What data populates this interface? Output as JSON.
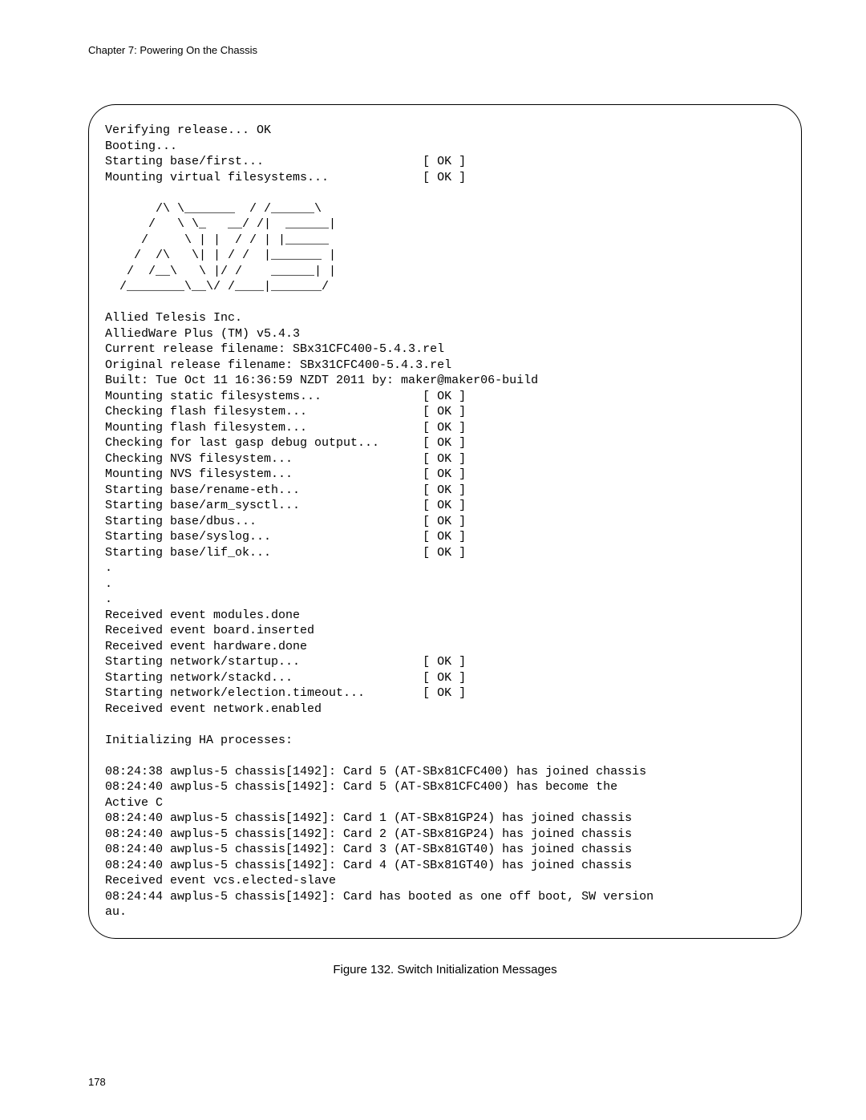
{
  "chapter": "Chapter 7: Powering On the Chassis",
  "console_text": "Verifying release... OK\nBooting...\nStarting base/first...                      [ OK ]\nMounting virtual filesystems...             [ OK ]\n\n       /\\ \\_______  / /______\\\n      /   \\ \\_   __/ /|  ______|\n     /     \\ | |  / / | |______\n    /  /\\   \\| | / /  |_______ |\n   /  /__\\   \\ |/ /    ______| |\n  /________\\__\\/ /____|_______/\n\nAllied Telesis Inc.\nAlliedWare Plus (TM) v5.4.3\nCurrent release filename: SBx31CFC400-5.4.3.rel\nOriginal release filename: SBx31CFC400-5.4.3.rel\nBuilt: Tue Oct 11 16:36:59 NZDT 2011 by: maker@maker06-build\nMounting static filesystems...              [ OK ]\nChecking flash filesystem...                [ OK ]\nMounting flash filesystem...                [ OK ]\nChecking for last gasp debug output...      [ OK ]\nChecking NVS filesystem...                  [ OK ]\nMounting NVS filesystem...                  [ OK ]\nStarting base/rename-eth...                 [ OK ]\nStarting base/arm_sysctl...                 [ OK ]\nStarting base/dbus...                       [ OK ]\nStarting base/syslog...                     [ OK ]\nStarting base/lif_ok...                     [ OK ]\n.\n.\n.\nReceived event modules.done\nReceived event board.inserted\nReceived event hardware.done\nStarting network/startup...                 [ OK ]\nStarting network/stackd...                  [ OK ]\nStarting network/election.timeout...        [ OK ]\nReceived event network.enabled\n\nInitializing HA processes:\n\n08:24:38 awplus-5 chassis[1492]: Card 5 (AT-SBx81CFC400) has joined chassis\n08:24:40 awplus-5 chassis[1492]: Card 5 (AT-SBx81CFC400) has become the \nActive C\n08:24:40 awplus-5 chassis[1492]: Card 1 (AT-SBx81GP24) has joined chassis\n08:24:40 awplus-5 chassis[1492]: Card 2 (AT-SBx81GP24) has joined chassis\n08:24:40 awplus-5 chassis[1492]: Card 3 (AT-SBx81GT40) has joined chassis\n08:24:40 awplus-5 chassis[1492]: Card 4 (AT-SBx81GT40) has joined chassis\nReceived event vcs.elected-slave\n08:24:44 awplus-5 chassis[1492]: Card has booted as one off boot, SW version \nau.",
  "figure_caption": "Figure 132. Switch Initialization Messages",
  "page_number": "178"
}
